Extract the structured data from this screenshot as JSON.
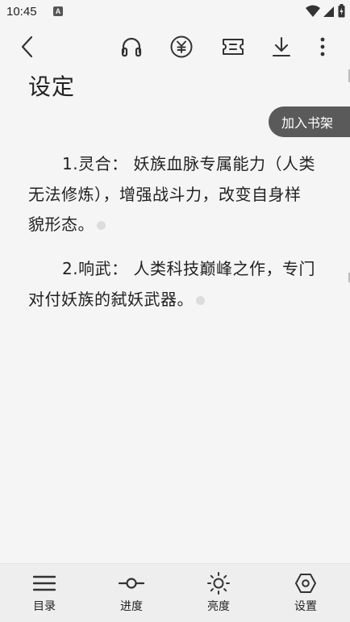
{
  "status_bar": {
    "time": "10:45",
    "notification_letter": "A"
  },
  "toolbar": {
    "back": "back-arrow-icon",
    "listen": "headphones-icon",
    "reward": "yuan-coin-icon",
    "ticket": "ticket-icon",
    "download": "download-icon",
    "more": "more-vertical-icon"
  },
  "reader": {
    "chapter_title": "设定",
    "add_to_shelf_label": "加入书架",
    "paragraphs": [
      "1.灵合： 妖族血脉专属能力（人类无法修炼），增强战斗力，改变自身样貌形态。",
      "2.响武： 人类科技巅峰之作，专门对付妖族的弑妖武器。"
    ]
  },
  "bottom_nav": {
    "items": [
      {
        "label": "目录",
        "icon": "menu-list-icon"
      },
      {
        "label": "进度",
        "icon": "progress-icon"
      },
      {
        "label": "亮度",
        "icon": "brightness-icon"
      },
      {
        "label": "设置",
        "icon": "settings-icon"
      }
    ]
  },
  "colors": {
    "background": "#f5f5f5",
    "shelf_button": "#5a5a5a",
    "bottom_nav": "#eeeeee",
    "text": "#222222"
  }
}
